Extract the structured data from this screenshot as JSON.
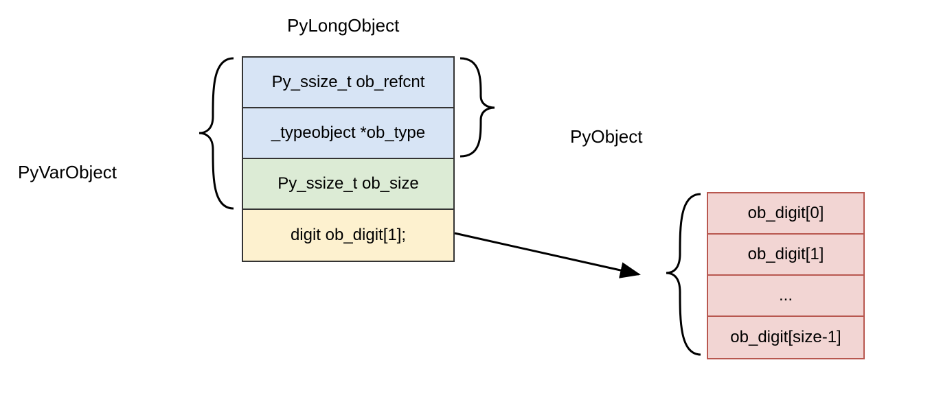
{
  "title": "PyLongObject",
  "left_group_label": "PyVarObject",
  "right_group_label": "PyObject",
  "main_cells": {
    "c0": "Py_ssize_t ob_refcnt",
    "c1": "_typeobject *ob_type",
    "c2": "Py_ssize_t ob_size",
    "c3": "digit ob_digit[1];"
  },
  "digit_cells": {
    "d0": "ob_digit[0]",
    "d1": "ob_digit[1]",
    "d2": "...",
    "d3": "ob_digit[size-1]"
  }
}
